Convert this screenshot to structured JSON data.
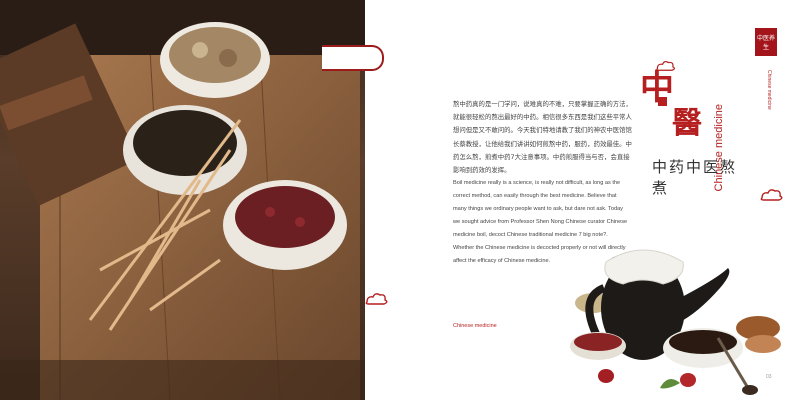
{
  "article": {
    "title_char_1": "中",
    "title_char_2": "醫",
    "title_cn": "中药中医熬煮",
    "title_en": "Chinese medicine",
    "body_cn": "熬中药真的是一门学问，说难真的不难，只要掌握正确的方法，就能很轻松的熬出最好的中药。相信很多东西是我们这些平常人想问但是又不敢问的。今天我们特地请教了我们的神农中医馆馆长蔡教授，让他给我们讲讲如何煎熬中药，服药，药效最佳。中药怎么熬，煎煮中药7大注意事项。中药煎服得当与否，会直接影响到药效的发挥。",
    "body_en": "Boil medicine really is a science, is really not difficult, as long as the correct method, can easily through the best medicine. Believe that many things we ordinary people want to ask, but dare not ask. Today we sought advice from Professor Shen Nong Chinese curator Chinese medicine boil, decoct Chinese traditional medicine 7 big note?. Whether the Chinese medicine is decocted properly or not will directly affect the efficacy of Chinese medicine.",
    "footer_tag": "Chinese medicine"
  },
  "page": {
    "seal_text": "中医养生",
    "side_label": "Chinese medicine",
    "page_number": "03"
  },
  "colors": {
    "accent_red": "#b51f1f",
    "text_gray": "#444444",
    "wood_dark": "#3a2a1f"
  },
  "images": {
    "left_photo": "bowls-of-dried-herbs-on-wooden-board",
    "bottom_right_photo": "clay-teapot-with-decoction-and-herbs"
  }
}
